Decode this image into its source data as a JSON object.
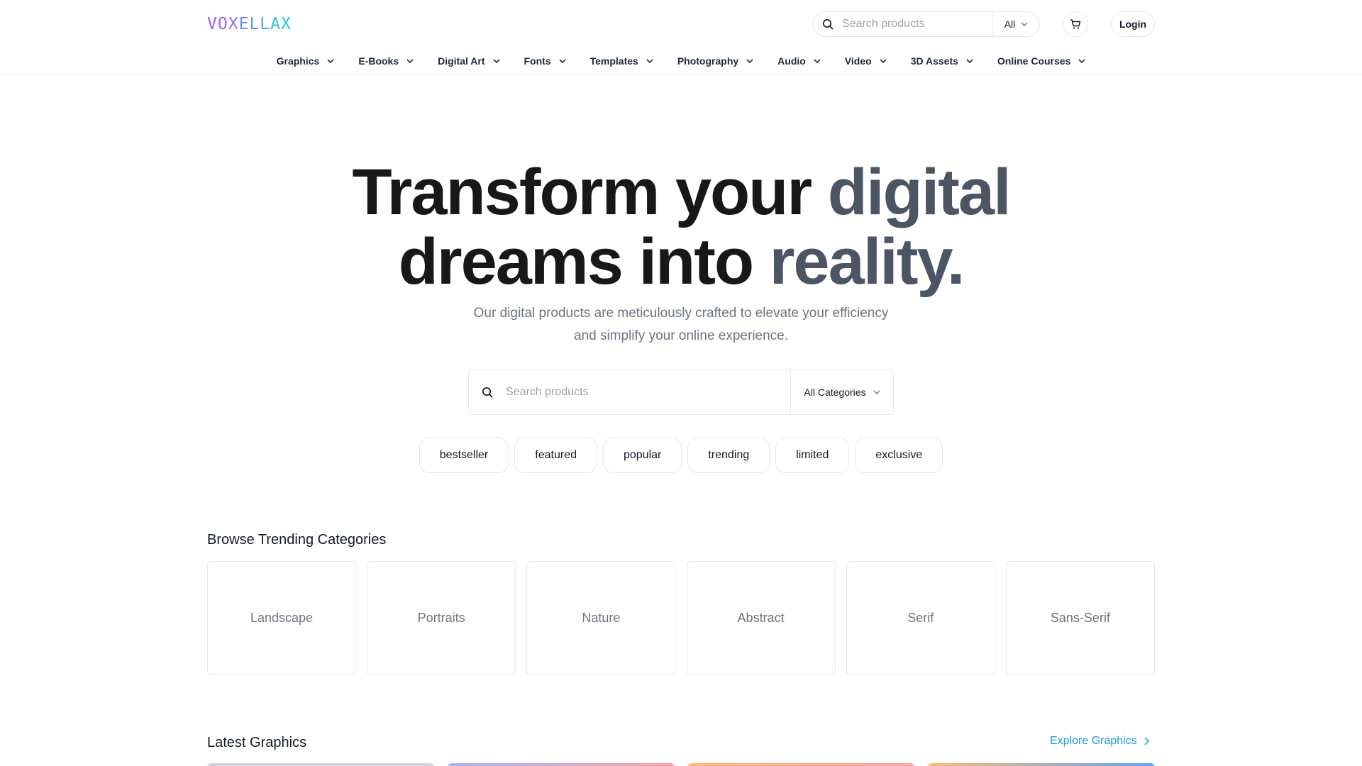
{
  "brand": {
    "logo_letters": [
      "V",
      "O",
      "X",
      "E",
      "L",
      "L",
      "A",
      "X"
    ],
    "logo_colors": [
      "#a855f7",
      "#9b63f2",
      "#8b75ee",
      "#7687ea",
      "#5f9ae6",
      "#4aabe2",
      "#35bcde",
      "#22c9db"
    ]
  },
  "header": {
    "search_placeholder": "Search products",
    "search_scope": "All",
    "cart_icon": "cart-icon",
    "login_label": "Login"
  },
  "nav": {
    "items": [
      {
        "label": "Graphics"
      },
      {
        "label": "E-Books"
      },
      {
        "label": "Digital Art"
      },
      {
        "label": "Fonts"
      },
      {
        "label": "Templates"
      },
      {
        "label": "Photography"
      },
      {
        "label": "Audio"
      },
      {
        "label": "Video"
      },
      {
        "label": "3D Assets"
      },
      {
        "label": "Online Courses"
      }
    ]
  },
  "hero": {
    "title_line1_dark": "Transform your ",
    "title_line1_gray": "digital",
    "title_line2_dark": "dreams into ",
    "title_line2_gray": "reality.",
    "subtitle": "Our digital products are meticulously crafted to elevate your efficiency and simplify your online experience.",
    "search_placeholder": "Search products",
    "category_select": "All Categories"
  },
  "tags": [
    "bestseller",
    "featured",
    "popular",
    "trending",
    "limited",
    "exclusive"
  ],
  "trending": {
    "title": "Browse Trending Categories",
    "categories": [
      "Landscape",
      "Portraits",
      "Nature",
      "Abstract",
      "Serif",
      "Sans-Serif"
    ]
  },
  "latest": {
    "title": "Latest Graphics",
    "explore_label": "Explore Graphics"
  },
  "colors": {
    "accent_link": "#1d9bd6",
    "title_dark": "#18181b",
    "title_gray": "#4b5563"
  }
}
